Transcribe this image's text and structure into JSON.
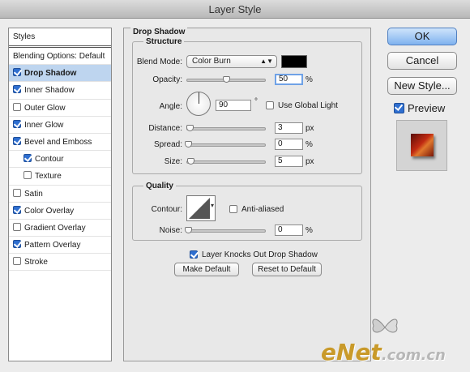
{
  "window": {
    "title": "Layer Style"
  },
  "sidebar": {
    "items": [
      {
        "label": "Styles",
        "checkbox": null,
        "selected": false,
        "indent": false
      },
      {
        "label": "Blending Options: Default",
        "checkbox": null,
        "selected": false,
        "indent": false
      },
      {
        "label": "Drop Shadow",
        "checkbox": true,
        "selected": true,
        "indent": false
      },
      {
        "label": "Inner Shadow",
        "checkbox": true,
        "selected": false,
        "indent": false
      },
      {
        "label": "Outer Glow",
        "checkbox": false,
        "selected": false,
        "indent": false
      },
      {
        "label": "Inner Glow",
        "checkbox": true,
        "selected": false,
        "indent": false
      },
      {
        "label": "Bevel and Emboss",
        "checkbox": true,
        "selected": false,
        "indent": false
      },
      {
        "label": "Contour",
        "checkbox": true,
        "selected": false,
        "indent": true
      },
      {
        "label": "Texture",
        "checkbox": false,
        "selected": false,
        "indent": true
      },
      {
        "label": "Satin",
        "checkbox": false,
        "selected": false,
        "indent": false
      },
      {
        "label": "Color Overlay",
        "checkbox": true,
        "selected": false,
        "indent": false
      },
      {
        "label": "Gradient Overlay",
        "checkbox": false,
        "selected": false,
        "indent": false
      },
      {
        "label": "Pattern Overlay",
        "checkbox": true,
        "selected": false,
        "indent": false
      },
      {
        "label": "Stroke",
        "checkbox": false,
        "selected": false,
        "indent": false
      }
    ]
  },
  "panel": {
    "title": "Drop Shadow",
    "structure": {
      "title": "Structure",
      "blend_mode_label": "Blend Mode:",
      "blend_mode_value": "Color Burn",
      "shadow_color": "#000000",
      "opacity_label": "Opacity:",
      "opacity_value": "50",
      "opacity_level": 0.5,
      "angle_label": "Angle:",
      "angle_value": "90",
      "angle_unit": "°",
      "global_light_label": "Use Global Light",
      "global_light_checked": false,
      "distance_label": "Distance:",
      "distance_value": "3",
      "spread_label": "Spread:",
      "spread_value": "0",
      "size_label": "Size:",
      "size_value": "5",
      "unit_px": "px",
      "unit_pct": "%"
    },
    "quality": {
      "title": "Quality",
      "contour_label": "Contour:",
      "anti_aliased_label": "Anti-aliased",
      "anti_aliased_checked": false,
      "noise_label": "Noise:",
      "noise_value": "0",
      "unit_pct": "%"
    },
    "knockout_label": "Layer Knocks Out Drop Shadow",
    "knockout_checked": true,
    "make_default_label": "Make Default",
    "reset_default_label": "Reset to Default"
  },
  "actions": {
    "ok_label": "OK",
    "cancel_label": "Cancel",
    "new_style_label": "New Style...",
    "preview_label": "Preview",
    "preview_checked": true
  },
  "watermark": {
    "brand": "eNet",
    "domain": ".com.cn"
  }
}
